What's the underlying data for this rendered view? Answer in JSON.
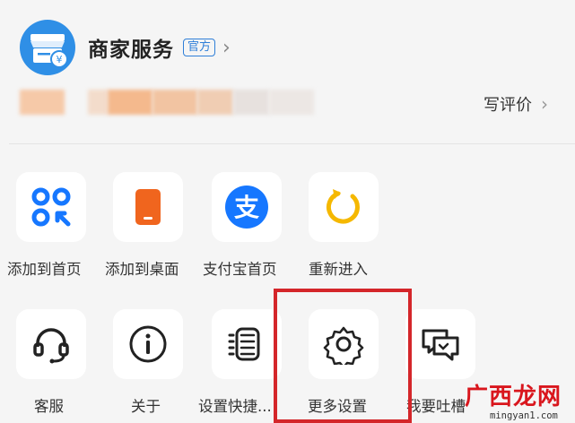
{
  "header": {
    "title": "商家服务",
    "badge": "官方",
    "title_chevron": "›",
    "review_label": "写评价",
    "review_chevron": "›"
  },
  "actions_row1": [
    {
      "label": "添加到首页",
      "icon": "qr-scan-icon"
    },
    {
      "label": "添加到桌面",
      "icon": "phone-desktop-icon"
    },
    {
      "label": "支付宝首页",
      "icon": "alipay-icon"
    },
    {
      "label": "重新进入",
      "icon": "refresh-icon"
    }
  ],
  "actions_row2": [
    {
      "label": "客服",
      "icon": "headset-icon"
    },
    {
      "label": "关于",
      "icon": "info-icon"
    },
    {
      "label": "设置快捷...",
      "icon": "list-icon"
    },
    {
      "label": "更多设置",
      "icon": "gear-icon"
    },
    {
      "label": "我要吐槽",
      "icon": "feedback-icon"
    }
  ],
  "watermark": {
    "text_cn": "广西龙网",
    "url": "mingyan1.com"
  },
  "colors": {
    "brand_blue": "#2f8fe6",
    "alipay_blue": "#1677ff",
    "orange": "#f0651e",
    "yellow": "#f5b800",
    "highlight_red": "#d4262a"
  }
}
